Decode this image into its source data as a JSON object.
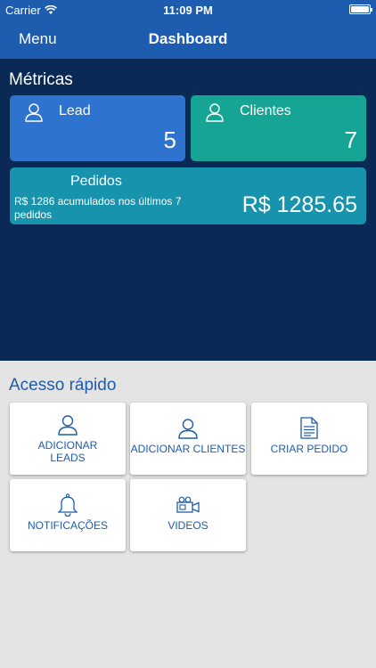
{
  "status_bar": {
    "carrier": "Carrier",
    "time": "11:09 PM"
  },
  "nav": {
    "menu": "Menu",
    "title": "Dashboard"
  },
  "metrics": {
    "title": "Métricas",
    "lead": {
      "label": "Lead",
      "value": "5"
    },
    "clients": {
      "label": "Clientes",
      "value": "7"
    },
    "orders": {
      "label": "Pedidos",
      "description": "R$ 1286 acumulados nos últimos 7 pedidos",
      "value": "R$ 1285.65"
    }
  },
  "quick_access": {
    "title": "Acesso rápido",
    "tiles": [
      {
        "label": "ADICIONAR LEADS",
        "icon": "user-icon"
      },
      {
        "label": "ADICIONAR CLIENTES",
        "icon": "user-icon"
      },
      {
        "label": "CRIAR PEDIDO",
        "icon": "document-icon"
      },
      {
        "label": "NOTIFICAÇÕES",
        "icon": "bell-icon"
      },
      {
        "label": "VIDEOS",
        "icon": "video-camera-icon"
      }
    ]
  },
  "colors": {
    "primary": "#1d5cae",
    "metrics_bg": "#0a2a55",
    "lead_card": "#2e73cf",
    "clients_card": "#16a595",
    "orders_card": "#1793ad",
    "page_bg": "#e4e4e4"
  }
}
